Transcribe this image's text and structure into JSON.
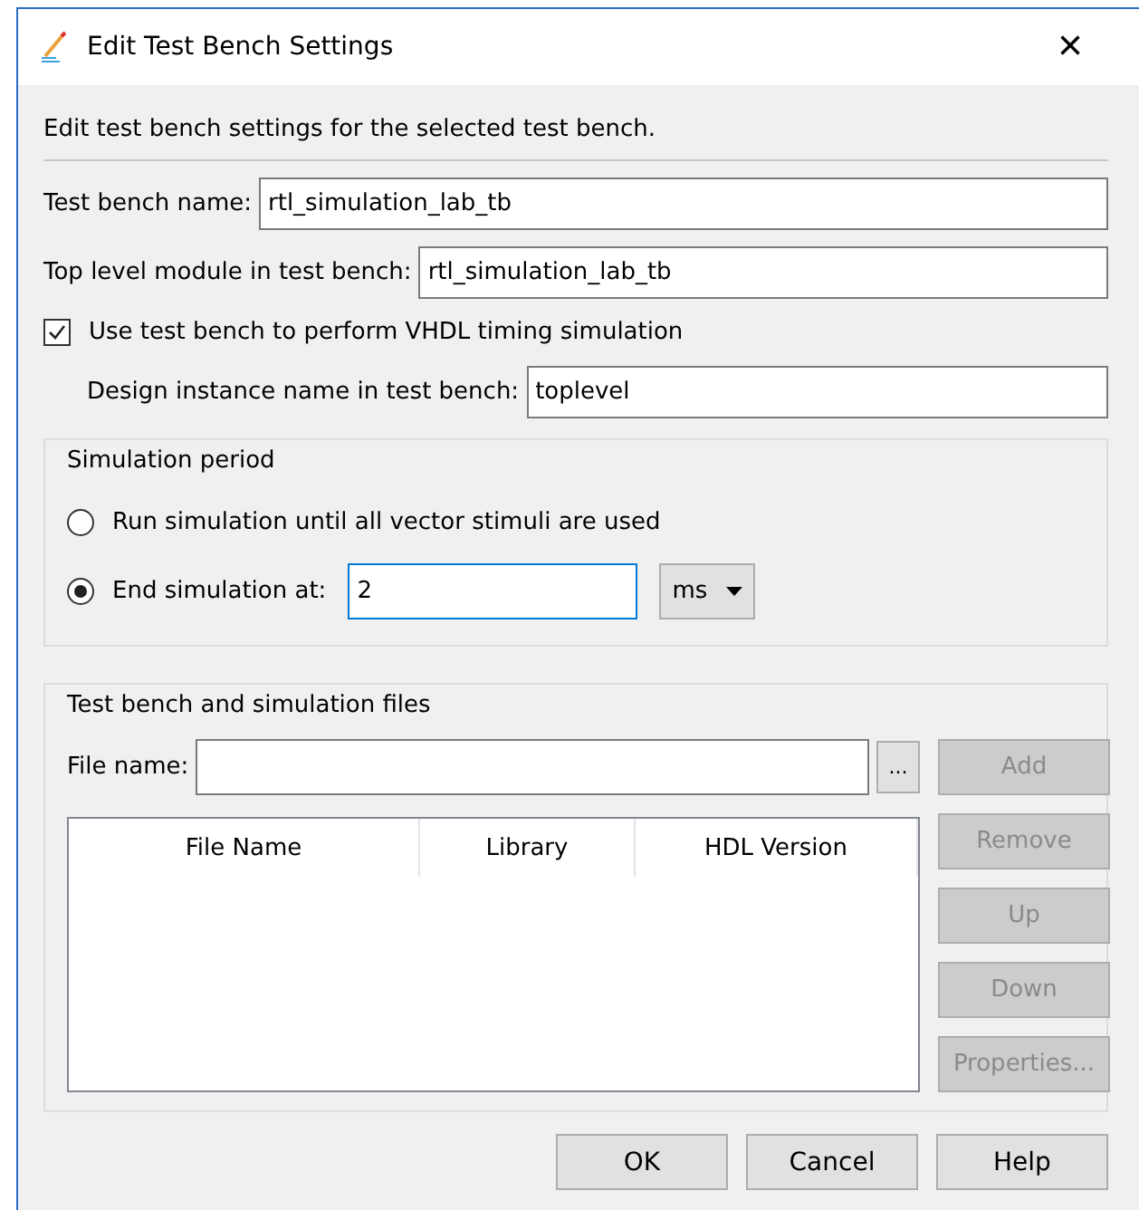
{
  "window": {
    "title": "Edit Test Bench Settings",
    "close": "×"
  },
  "description": "Edit test bench settings for the selected test bench.",
  "test_bench_name": {
    "label": "Test bench name:",
    "value": "rtl_simulation_lab_tb"
  },
  "top_level_module": {
    "label": "Top level module in test bench:",
    "value": "rtl_simulation_lab_tb"
  },
  "use_test_bench": {
    "label": "Use test bench to perform VHDL timing simulation",
    "checked": true
  },
  "design_instance": {
    "label": "Design instance name in test bench:",
    "value": "toplevel"
  },
  "simulation_period": {
    "title": "Simulation period",
    "options": [
      {
        "label": "Run simulation until all vector stimuli are used",
        "selected": false
      },
      {
        "label": "End simulation at:",
        "selected": true
      }
    ],
    "end_value": "2",
    "unit": "ms"
  },
  "files": {
    "title": "Test bench and simulation files",
    "file_name_label": "File name:",
    "browse": "...",
    "columns": [
      "File Name",
      "Library",
      "HDL Version"
    ],
    "side_buttons": [
      {
        "label": "Add",
        "disabled": true
      },
      {
        "label": "Remove",
        "disabled": true
      },
      {
        "label": "Up",
        "disabled": true
      },
      {
        "label": "Down",
        "disabled": true
      },
      {
        "label": "Properties...",
        "disabled": true
      }
    ]
  },
  "buttons": [
    "OK",
    "Cancel",
    "Help"
  ]
}
